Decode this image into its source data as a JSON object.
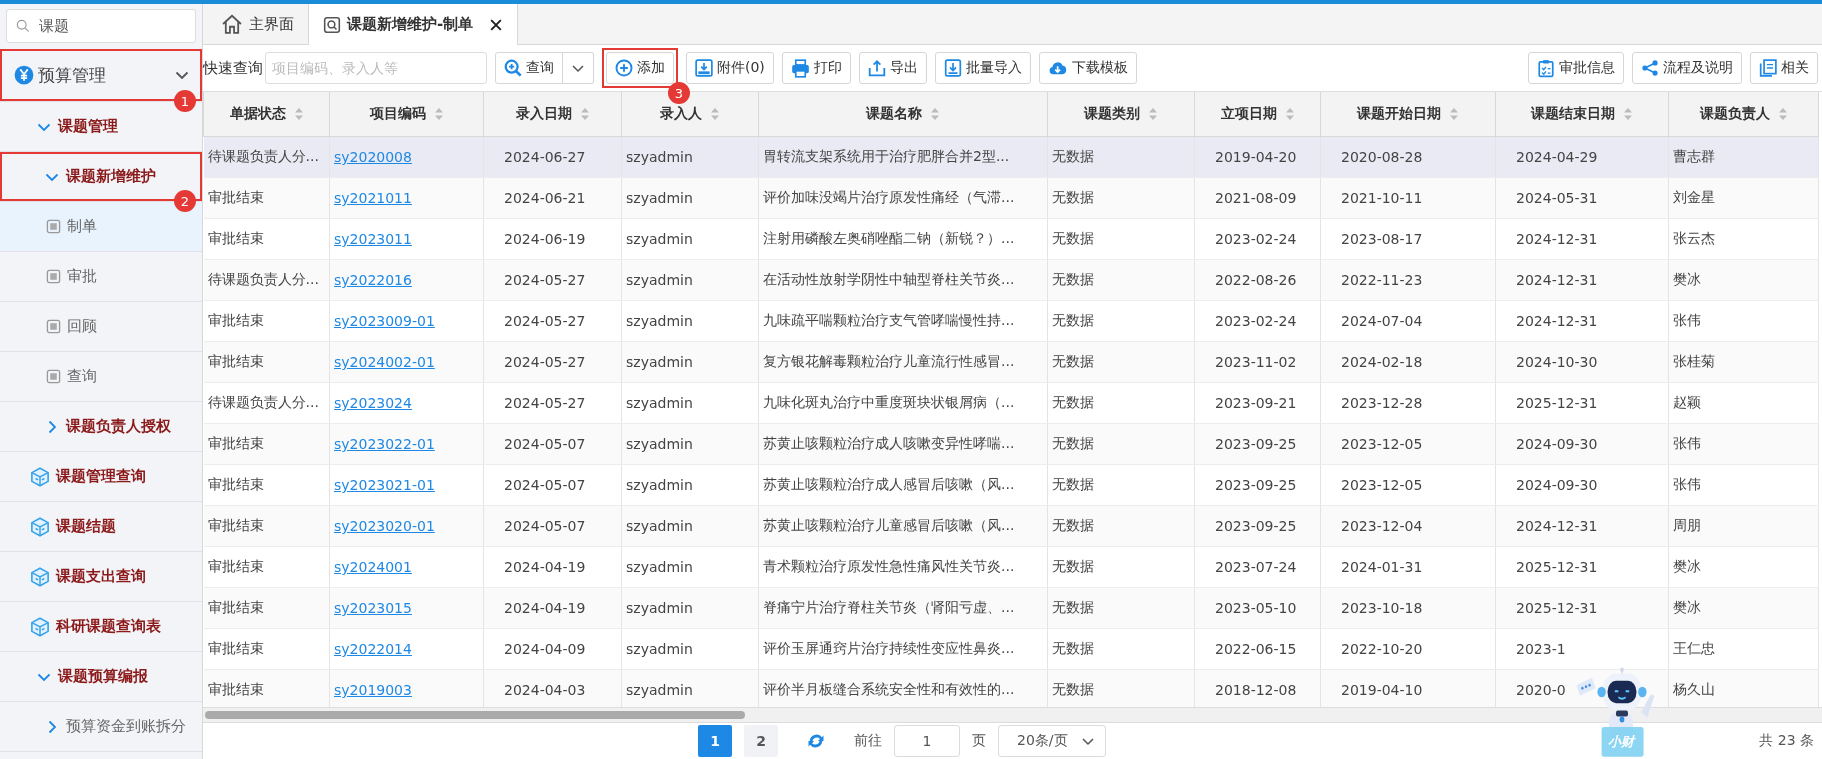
{
  "sidebar": {
    "search": {
      "value": "课题"
    },
    "items": [
      {
        "label": "预算管理",
        "kind": "root",
        "expanded": true,
        "callout": "1",
        "children": [
          {
            "label": "课题管理",
            "kind": "folder",
            "expanded": true,
            "children": [
              {
                "label": "课题新增维护",
                "kind": "folder",
                "expanded": true,
                "callout": "2",
                "children": [
                  {
                    "label": "制单",
                    "kind": "page",
                    "selected": true
                  },
                  {
                    "label": "审批",
                    "kind": "page",
                    "selected": false
                  },
                  {
                    "label": "回顾",
                    "kind": "page",
                    "selected": false
                  },
                  {
                    "label": "查询",
                    "kind": "page",
                    "selected": false
                  }
                ]
              },
              {
                "label": "课题负责人授权",
                "kind": "folder",
                "expanded": false
              }
            ]
          },
          {
            "label": "课题管理查询",
            "kind": "module"
          },
          {
            "label": "课题结题",
            "kind": "module"
          },
          {
            "label": "课题支出查询",
            "kind": "module"
          },
          {
            "label": "科研课题查询表",
            "kind": "module"
          },
          {
            "label": "课题预算编报",
            "kind": "folder",
            "expanded": true,
            "children": [
              {
                "label": "预算资金到账拆分",
                "kind": "link",
                "expanded": false
              }
            ]
          }
        ]
      }
    ]
  },
  "tabs": [
    {
      "label": "主界面",
      "kind": "home",
      "selected": false
    },
    {
      "label": "课题新增维护-制单",
      "kind": "page",
      "selected": true,
      "closable": true
    }
  ],
  "toolbar": {
    "quick_search": {
      "label": "快速查询",
      "placeholder": "项目编码、录入人等"
    },
    "buttons": [
      {
        "label": "查询",
        "kind": "search"
      },
      {
        "label": "添加",
        "kind": "add",
        "callout": "3"
      },
      {
        "label": "附件(0)",
        "kind": "attach"
      },
      {
        "label": "打印",
        "kind": "print"
      },
      {
        "label": "导出",
        "kind": "export"
      },
      {
        "label": "批量导入",
        "kind": "import"
      },
      {
        "label": "下载模板",
        "kind": "download"
      }
    ],
    "right_buttons": [
      {
        "label": "审批信息",
        "kind": "approval"
      },
      {
        "label": "流程及说明",
        "kind": "flow"
      },
      {
        "label": "相关",
        "kind": "related"
      }
    ]
  },
  "table": {
    "columns": [
      {
        "label": "单据状态",
        "kind": "text"
      },
      {
        "label": "项目编码",
        "kind": "link"
      },
      {
        "label": "录入日期",
        "kind": "date"
      },
      {
        "label": "录入人",
        "kind": "text"
      },
      {
        "label": "课题名称",
        "kind": "text"
      },
      {
        "label": "课题类别",
        "kind": "text"
      },
      {
        "label": "立项日期",
        "kind": "date"
      },
      {
        "label": "课题开始日期",
        "kind": "date"
      },
      {
        "label": "课题结束日期",
        "kind": "date"
      },
      {
        "label": "课题负责人",
        "kind": "text"
      }
    ],
    "rows": [
      {
        "selected": true,
        "cells": [
          "待课题负责人分...",
          "sy2020008",
          "2024-06-27",
          "szyadmin",
          "胃转流支架系统用于治疗肥胖合并2型...",
          "无数据",
          "2019-04-20",
          "2020-08-28",
          "2024-04-29",
          "曹志群"
        ]
      },
      {
        "selected": false,
        "cells": [
          "审批结束",
          "sy2021011",
          "2024-06-21",
          "szyadmin",
          "评价加味没竭片治疗原发性痛经（气滞...",
          "无数据",
          "2021-08-09",
          "2021-10-11",
          "2024-05-31",
          "刘金星"
        ]
      },
      {
        "selected": false,
        "cells": [
          "审批结束",
          "sy2023011",
          "2024-06-19",
          "szyadmin",
          "注射用磷酸左奥硝唑酯二钠（新锐？）...",
          "无数据",
          "2023-02-24",
          "2023-08-17",
          "2024-12-31",
          "张云杰"
        ]
      },
      {
        "selected": false,
        "cells": [
          "待课题负责人分...",
          "sy2022016",
          "2024-05-27",
          "szyadmin",
          "在活动性放射学阴性中轴型脊柱关节炎...",
          "无数据",
          "2022-08-26",
          "2022-11-23",
          "2024-12-31",
          "樊冰"
        ]
      },
      {
        "selected": false,
        "cells": [
          "审批结束",
          "sy2023009-01",
          "2024-05-27",
          "szyadmin",
          "九味疏平喘颗粒治疗支气管哮喘慢性持...",
          "无数据",
          "2023-02-24",
          "2024-07-04",
          "2024-12-31",
          "张伟"
        ]
      },
      {
        "selected": false,
        "cells": [
          "审批结束",
          "sy2024002-01",
          "2024-05-27",
          "szyadmin",
          "复方银花解毒颗粒治疗儿童流行性感冒...",
          "无数据",
          "2023-11-02",
          "2024-02-18",
          "2024-10-30",
          "张桂菊"
        ]
      },
      {
        "selected": false,
        "cells": [
          "待课题负责人分...",
          "sy2023024",
          "2024-05-27",
          "szyadmin",
          "九味化斑丸治疗中重度斑块状银屑病（...",
          "无数据",
          "2023-09-21",
          "2023-12-28",
          "2025-12-31",
          "赵颖"
        ]
      },
      {
        "selected": false,
        "cells": [
          "审批结束",
          "sy2023022-01",
          "2024-05-07",
          "szyadmin",
          "苏黄止咳颗粒治疗成人咳嗽变异性哮喘...",
          "无数据",
          "2023-09-25",
          "2023-12-05",
          "2024-09-30",
          "张伟"
        ]
      },
      {
        "selected": false,
        "cells": [
          "审批结束",
          "sy2023021-01",
          "2024-05-07",
          "szyadmin",
          "苏黄止咳颗粒治疗成人感冒后咳嗽（风...",
          "无数据",
          "2023-09-25",
          "2023-12-05",
          "2024-09-30",
          "张伟"
        ]
      },
      {
        "selected": false,
        "cells": [
          "审批结束",
          "sy2023020-01",
          "2024-05-07",
          "szyadmin",
          "苏黄止咳颗粒治疗儿童感冒后咳嗽（风...",
          "无数据",
          "2023-09-25",
          "2023-12-04",
          "2024-12-31",
          "周朋"
        ]
      },
      {
        "selected": false,
        "cells": [
          "审批结束",
          "sy2024001",
          "2024-04-19",
          "szyadmin",
          "青术颗粒治疗原发性急性痛风性关节炎...",
          "无数据",
          "2023-07-24",
          "2024-01-31",
          "2025-12-31",
          "樊冰"
        ]
      },
      {
        "selected": false,
        "cells": [
          "审批结束",
          "sy2023015",
          "2024-04-19",
          "szyadmin",
          "脊痛宁片治疗脊柱关节炎（肾阳亏虚、...",
          "无数据",
          "2023-05-10",
          "2023-10-18",
          "2025-12-31",
          "樊冰"
        ]
      },
      {
        "selected": false,
        "cells": [
          "审批结束",
          "sy2022014",
          "2024-04-09",
          "szyadmin",
          "评价玉屏通窍片治疗持续性变应性鼻炎...",
          "无数据",
          "2022-06-15",
          "2022-10-20",
          "2023-1",
          "王仁忠"
        ]
      },
      {
        "selected": false,
        "cells": [
          "审批结束",
          "sy2019003",
          "2024-04-03",
          "szyadmin",
          "评价半月板缝合系统安全性和有效性的...",
          "无数据",
          "2018-12-08",
          "2019-04-10",
          "2020-0",
          "杨久山"
        ]
      }
    ]
  },
  "pager": {
    "pages": [
      {
        "label": "1",
        "selected": true
      },
      {
        "label": "2",
        "selected": false
      }
    ],
    "goto_label": "前往",
    "goto_value": "1",
    "goto_suffix": "页",
    "page_size": "20条/页",
    "total": "共 23 条"
  },
  "mascot": {
    "label": "小财"
  }
}
